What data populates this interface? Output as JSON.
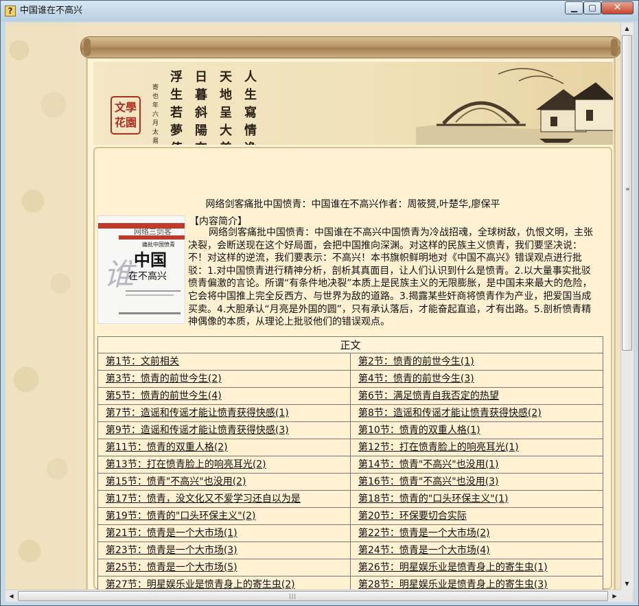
{
  "window": {
    "title": "中国谁在不高兴",
    "icon": "question-icon",
    "controls": {
      "minimize": "▁",
      "maximize": "□",
      "close": "✕"
    }
  },
  "banner": {
    "poem_lines": [
      "人生寫情逸",
      "天地呈大美",
      "日暮斜陽奔",
      "浮生若夢倚"
    ],
    "small_text": "寄也年六月 太易",
    "seal": "文學花園"
  },
  "book": {
    "title": "网络剑客痛批中国愤青：中国谁在不高兴作者：周筱赟,叶楚华,廖保平",
    "cover": {
      "top_text": "网络三剑客",
      "sub_text": "痛批中国愤青",
      "big_text": "中国",
      "side_text": "谁",
      "small_title": "在不高兴"
    },
    "intro_heading": "【内容简介】",
    "intro": "网络剑客痛批中国愤青：中国谁在不高兴中国愤青为冷战招魂，全球树敌，仇恨文明，主张决裂，会断送现在这个好局面，会把中国推向深渊。对这样的民族主义愤青，我们要坚决说：不！对这样的逆流，我们要表示：不高兴！本书旗帜鲜明地对《中国不高兴》错误观点进行批驳：1.对中国愤青进行精神分析，剖析其真面目，让人们认识到什么是愤青。2.以大量事实批驳愤青偏激的言论。所谓“有条件地决裂”本质上是民族主义的无限膨胀，是中国未来最大的危险，它会将中国推上完全反西方、与世界为敌的道路。3.揭露某些奸商将愤青作为产业，把爱国当成买卖。4.大胆承认“月亮是外国的圆”，只有承认落后，才能奋起直追，才有出路。5.剖析愤青精神偶像的本质，从理论上批驳他们的错误观点。"
  },
  "toc": {
    "header": "正文",
    "rows": [
      [
        "第1节：文前相关",
        "第2节：愤青的前世今生(1)"
      ],
      [
        "第3节：愤青的前世今生(2)",
        "第4节：愤青的前世今生(3)"
      ],
      [
        "第5节：愤青的前世今生(4)",
        "第6节：满足愤青自我否定的热望"
      ],
      [
        "第7节：造谣和传谣才能让愤青获得快感(1)",
        "第8节：造谣和传谣才能让愤青获得快感(2)"
      ],
      [
        "第9节：造谣和传谣才能让愤青获得快感(3)",
        "第10节：愤青的双重人格(1)"
      ],
      [
        "第11节：愤青的双重人格(2)",
        "第12节：打在愤青脸上的响亮耳光(1)"
      ],
      [
        "第13节：打在愤青脸上的响亮耳光(2)",
        "第14节：愤青\"不高兴\"也没用(1)"
      ],
      [
        "第15节：愤青\"不高兴\"也没用(2)",
        "第16节：愤青\"不高兴\"也没用(3)"
      ],
      [
        "第17节：愤青，没文化又不爱学习还自以为是",
        "第18节：愤青的\"口头环保主义\"(1)"
      ],
      [
        "第19节：愤青的\"口头环保主义\"(2)",
        "第20节：环保要切合实际"
      ],
      [
        "第21节：愤青是一个大市场(1)",
        "第22节：愤青是一个大市场(2)"
      ],
      [
        "第23节：愤青是一个大市场(3)",
        "第24节：愤青是一个大市场(4)"
      ],
      [
        "第25节：愤青是一个大市场(5)",
        "第26节：明星娱乐业是愤青身上的寄生虫(1)"
      ],
      [
        "第27节：明星娱乐业是愤青身上的寄生虫(2)",
        "第28节：明星娱乐业是愤青身上的寄生虫(3)"
      ]
    ]
  },
  "scrollbars": {
    "up": "▲",
    "down": "▼",
    "left": "◀",
    "right": "▶",
    "v_grip": "≡",
    "h_grip": "|||"
  }
}
